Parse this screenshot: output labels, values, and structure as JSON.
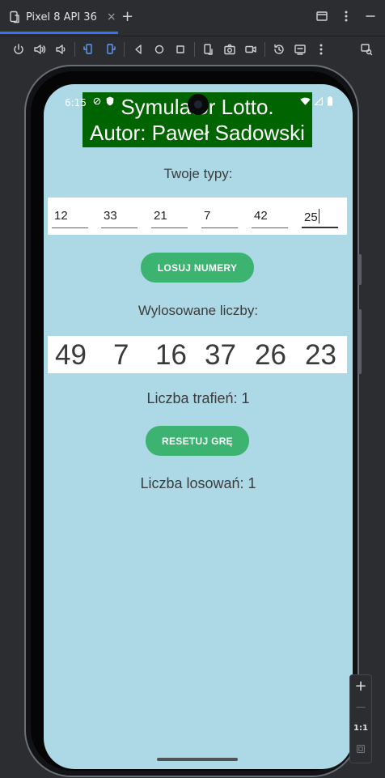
{
  "ide": {
    "tab_label": "Pixel 8 API 36",
    "tab_close": "×",
    "tab_add": "+",
    "zoom_label": "1:1",
    "zoom_in": "+",
    "zoom_out": "—"
  },
  "status_bar": {
    "time": "6:15"
  },
  "app": {
    "title_line1": "Symulator Lotto.",
    "title_line2": "Autor: Paweł Sadowski",
    "your_picks_label": "Twoje typy:",
    "picks": [
      "12",
      "33",
      "21",
      "7",
      "42",
      "25"
    ],
    "draw_button": "LOSUJ NUMERY",
    "drawn_label": "Wylosowane liczby:",
    "drawn": [
      "49",
      "7",
      "16",
      "37",
      "26",
      "23"
    ],
    "hits_text": "Liczba trafień: 1",
    "reset_button": "RESETUJ GRĘ",
    "draws_text": "Liczba losowań: 1"
  },
  "colors": {
    "screen_bg": "#add8e6",
    "title_bg": "#006400",
    "button_bg": "#3cb371",
    "tab_accent": "#3574f0"
  }
}
